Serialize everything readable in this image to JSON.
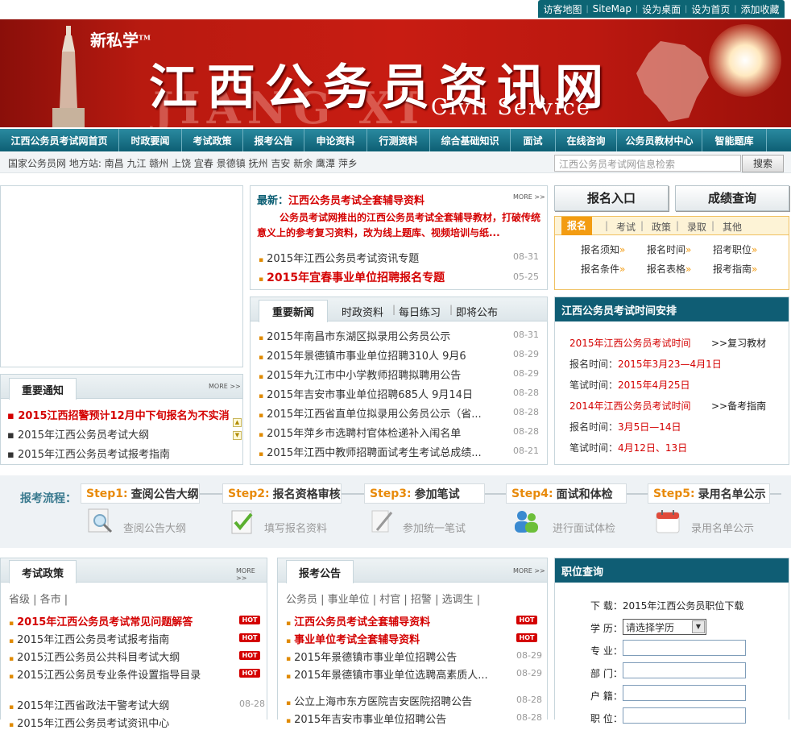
{
  "top_links": [
    "访客地图",
    "SiteMap",
    "设为桌面",
    "设为首页",
    "添加收藏"
  ],
  "banner": {
    "brand": "新私学",
    "brand_mark": "TM",
    "title": "江西公务员资讯网",
    "watermark": "JIANG XI",
    "subtitle": "Civil Service"
  },
  "nav": [
    "江西公务员考试网首页",
    "时政要闻",
    "考试政策",
    "报考公告",
    "申论资料",
    "行测资料",
    "综合基础知识",
    "面试",
    "在线咨询",
    "公务员教材中心",
    "智能题库"
  ],
  "subbar": {
    "cities": "国家公务员网 地方站: 南昌 九江 赣州 上饶 宜春 景德镇 抚州 吉安 新余 鹰潭 萍乡",
    "search_placeholder": "江西公务员考试网信息检索",
    "search_button": "搜索"
  },
  "notice": {
    "title": "重要通知",
    "more": "MORE >>",
    "items": [
      "2015江西招警预计12月中下旬报名为不实消",
      "2015年江西公务员考试大纲",
      "2015年江西公务员考试报考指南"
    ]
  },
  "latest": {
    "label": "最新：",
    "headline": "江西公务员考试全套辅导资料",
    "more": "MORE >>",
    "desc": "公务员考试网推出的江西公务员考试全套辅导教材，打破传统意义上的参考复习资料，改为线上题库、视频培训与纸...",
    "items": [
      {
        "text": "2015年江西公务员考试资讯专题",
        "date": "08-31"
      },
      {
        "text": "2015年宜春事业单位招聘报名专题",
        "date": "05-25"
      }
    ]
  },
  "news": {
    "tabs": [
      "重要新闻",
      "时政资料",
      "每日练习",
      "即将公布"
    ],
    "items": [
      {
        "text": "2015年南昌市东湖区拟录用公务员公示",
        "date": "08-31"
      },
      {
        "text": "2015年景德镇市事业单位招聘310人 9月6",
        "date": "08-29"
      },
      {
        "text": "2015年九江市中小学教师招聘拟聘用公告",
        "date": "08-29"
      },
      {
        "text": "2015年吉安市事业单位招聘685人 9月14日",
        "date": "08-28"
      },
      {
        "text": "2015年江西省直单位拟录用公务员公示（省...",
        "date": "08-28"
      },
      {
        "text": "2015年萍乡市选聘村官体检递补入闱名单",
        "date": "08-28"
      },
      {
        "text": "2015年江西中教师招聘面试考生考试总成绩...",
        "date": "08-21"
      }
    ]
  },
  "buttons": {
    "signup": "报名入口",
    "score": "成绩查询"
  },
  "regtabs": {
    "tabs": [
      "报名",
      "考试",
      "政策",
      "录取",
      "其他"
    ],
    "links": [
      "报名须知",
      "报名时间",
      "招考职位",
      "报名条件",
      "报名表格",
      "报考指南"
    ]
  },
  "schedule": {
    "title": "江西公务员考试时间安排",
    "y2015": {
      "name": "2015年江西公务员考试时间",
      "link": "复习教材",
      "reg_label": "报名时间：",
      "reg": "2015年3月23—4月1日",
      "exam_label": "笔试时间：",
      "exam": "2015年4月25日"
    },
    "y2014": {
      "name": "2014年江西公务员考试时间",
      "link": "备考指南",
      "reg_label": "报名时间：",
      "reg": "3月5日—14日",
      "exam_label": "笔试时间：",
      "exam": "4月12日、13日"
    }
  },
  "process": {
    "label": "报考流程：",
    "steps": [
      {
        "num": "Step1:",
        "name": "查阅公告大纲",
        "sub": "查阅公告大纲"
      },
      {
        "num": "Step2:",
        "name": "报名资格审核",
        "sub": "填写报名资料"
      },
      {
        "num": "Step3:",
        "name": "参加笔试",
        "sub": "参加统一笔试"
      },
      {
        "num": "Step4:",
        "name": "面试和体检",
        "sub": "进行面试体检"
      },
      {
        "num": "Step5:",
        "name": "录用名单公示",
        "sub": "录用名单公示"
      }
    ]
  },
  "policy": {
    "title": "考试政策",
    "more": "MORE >>",
    "filters": "省级 | 各市 |",
    "hot": "HOT",
    "items": [
      {
        "text": "2015年江西公务员考试常见问题解答",
        "hot": true
      },
      {
        "text": "2015年江西公务员考试报考指南",
        "hot": true
      },
      {
        "text": "2015江西公务员公共科目考试大纲",
        "hot": true
      },
      {
        "text": "2015江西公务员专业条件设置指导目录",
        "hot": true
      },
      {
        "text": "2015年江西省政法干警考试大纲",
        "date": "08-28"
      },
      {
        "text": "2015年江西公务员考试资讯中心",
        "date": ""
      }
    ]
  },
  "announce": {
    "title": "报考公告",
    "more": "MORE >>",
    "filters": "公务员 | 事业单位 | 村官 | 招警 | 选调生 |",
    "hot": "HOT",
    "items": [
      {
        "text": "江西公务员考试全套辅导资料",
        "hot": true
      },
      {
        "text": "事业单位考试全套辅导资料",
        "hot": true
      },
      {
        "text": "2015年景德镇市事业单位招聘公告",
        "date": "08-29"
      },
      {
        "text": "2015年景德镇市事业单位选聘高素质人...",
        "date": "08-29"
      },
      {
        "text": "公立上海市东方医院吉安医院招聘公告",
        "date": "08-28"
      },
      {
        "text": "2015年吉安市事业单位招聘公告",
        "date": "08-28"
      }
    ]
  },
  "jobs": {
    "title": "职位查询",
    "download_label": "下 载：",
    "download": "2015年江西公务员职位下载",
    "edu_label": "学 历：",
    "edu_select": "请选择学历",
    "major_label": "专 业：",
    "dept_label": "部 门：",
    "hukou_label": "户 籍：",
    "pos_label": "职 位："
  }
}
